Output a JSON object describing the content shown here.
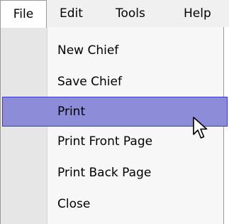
{
  "menubar": {
    "items": [
      {
        "label": "File",
        "active": true
      },
      {
        "label": "Edit",
        "active": false
      },
      {
        "label": "Tools",
        "active": false
      },
      {
        "label": "Help",
        "active": false
      }
    ]
  },
  "file_menu": {
    "items": [
      {
        "label": "New Chief",
        "highlighted": false
      },
      {
        "label": "Save Chief",
        "highlighted": false
      },
      {
        "label": "Print",
        "highlighted": true
      },
      {
        "label": "Print Front Page",
        "highlighted": false
      },
      {
        "label": "Print Back Page",
        "highlighted": false
      },
      {
        "label": "Close",
        "highlighted": false
      }
    ]
  },
  "colors": {
    "menubar_background": "#f0f0f0",
    "menu_background": "#f7f7f7",
    "gutter_background": "#e6e6e6",
    "highlight_fill": "#8c8cd8",
    "highlight_border": "#3a3ad0",
    "border": "#9a9a9a"
  },
  "cursor": {
    "icon": "arrow-pointer-icon"
  }
}
